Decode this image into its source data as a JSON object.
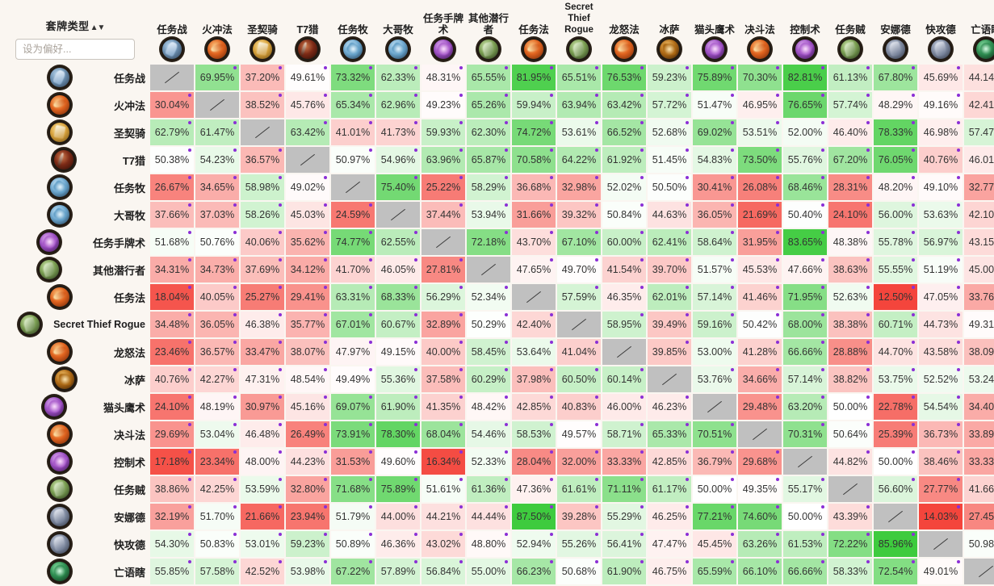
{
  "header": {
    "corner_title": "套牌类型",
    "sort_arrows": "▲▼",
    "search_placeholder": "设为偏好...",
    "search_value": ""
  },
  "legend": {
    "mirror_symbol": "/",
    "dot_color": "#8b2fd6",
    "mirror_color": "#c0c0c0",
    "high_color": "#3ecb3e",
    "mid_color": "#ffffff",
    "low_color": "#f4453c",
    "page_background": "#faf6f1"
  },
  "chart_data": {
    "type": "heatmap",
    "title": "套牌类型",
    "xlabel": "",
    "ylabel": "",
    "value_suffix": "%",
    "mirror_label": "/",
    "categories": [
      {
        "label": "任务战",
        "icon": "warrior-class-icon",
        "cls": "ic-warrior",
        "latin": false
      },
      {
        "label": "火冲法",
        "icon": "mage-class-icon",
        "cls": "ic-mage",
        "latin": false
      },
      {
        "label": "圣契骑",
        "icon": "paladin-class-icon",
        "cls": "ic-paladin",
        "latin": false
      },
      {
        "label": "T7猎",
        "icon": "hunter-class-icon",
        "cls": "ic-hunter",
        "latin": false
      },
      {
        "label": "任务牧",
        "icon": "priest-class-icon",
        "cls": "ic-priest",
        "latin": false
      },
      {
        "label": "大哥牧",
        "icon": "priest-class-icon",
        "cls": "ic-priest",
        "latin": false
      },
      {
        "label": "任务手牌术",
        "icon": "warlock-class-icon",
        "cls": "ic-warlock",
        "latin": false
      },
      {
        "label": "其他潜行者",
        "icon": "rogue-class-icon",
        "cls": "ic-rogue",
        "latin": false
      },
      {
        "label": "任务法",
        "icon": "mage-class-icon",
        "cls": "ic-mage",
        "latin": false
      },
      {
        "label": "Secret Thief Rogue",
        "icon": "rogue-class-icon",
        "cls": "ic-rogue",
        "latin": true
      },
      {
        "label": "龙怒法",
        "icon": "mage-class-icon",
        "cls": "ic-mage",
        "latin": false
      },
      {
        "label": "冰萨",
        "icon": "shaman-class-icon",
        "cls": "ic-shaman",
        "latin": false
      },
      {
        "label": "猫头鹰术",
        "icon": "warlock-class-icon",
        "cls": "ic-warlock",
        "latin": false
      },
      {
        "label": "决斗法",
        "icon": "mage-class-icon",
        "cls": "ic-mage",
        "latin": false
      },
      {
        "label": "控制术",
        "icon": "warlock-class-icon",
        "cls": "ic-warlock",
        "latin": false
      },
      {
        "label": "任务贼",
        "icon": "rogue-class-icon",
        "cls": "ic-rogue",
        "latin": false
      },
      {
        "label": "安娜德",
        "icon": "druid-class-icon",
        "cls": "ic-druid",
        "latin": false
      },
      {
        "label": "快攻德",
        "icon": "druid-class-icon",
        "cls": "ic-druid",
        "latin": false
      },
      {
        "label": "亡语瞎",
        "icon": "demonhunter-class-icon",
        "cls": "ic-dk",
        "latin": false
      }
    ],
    "rows": [
      {
        "label": "任务战",
        "icon": "warrior-class-icon",
        "cls": "ic-warrior",
        "latin": false,
        "values": [
          null,
          69.95,
          37.2,
          49.61,
          73.32,
          62.33,
          48.31,
          65.55,
          81.95,
          65.51,
          76.53,
          59.23,
          75.89,
          70.3,
          82.81,
          61.13,
          67.8,
          45.69,
          44.14
        ]
      },
      {
        "label": "火冲法",
        "icon": "mage-class-icon",
        "cls": "ic-mage",
        "latin": false,
        "values": [
          30.04,
          null,
          38.52,
          45.76,
          65.34,
          62.96,
          49.23,
          65.26,
          59.94,
          63.94,
          63.42,
          57.72,
          51.47,
          46.95,
          76.65,
          57.74,
          48.29,
          49.16,
          42.41
        ]
      },
      {
        "label": "圣契骑",
        "icon": "paladin-class-icon",
        "cls": "ic-paladin",
        "latin": false,
        "values": [
          62.79,
          61.47,
          null,
          63.42,
          41.01,
          41.73,
          59.93,
          62.3,
          74.72,
          53.61,
          66.52,
          52.68,
          69.02,
          53.51,
          52.0,
          46.4,
          78.33,
          46.98,
          57.47
        ]
      },
      {
        "label": "T7猎",
        "icon": "hunter-class-icon",
        "cls": "ic-hunter",
        "latin": false,
        "values": [
          50.38,
          54.23,
          36.57,
          null,
          50.97,
          54.96,
          63.96,
          65.87,
          70.58,
          64.22,
          61.92,
          51.45,
          54.83,
          73.5,
          55.76,
          67.2,
          76.05,
          40.76,
          46.01
        ]
      },
      {
        "label": "任务牧",
        "icon": "priest-class-icon",
        "cls": "ic-priest",
        "latin": false,
        "values": [
          26.67,
          34.65,
          58.98,
          49.02,
          null,
          75.4,
          25.22,
          58.29,
          36.68,
          32.98,
          52.02,
          50.5,
          30.41,
          26.08,
          68.46,
          28.31,
          48.2,
          49.1,
          32.77
        ]
      },
      {
        "label": "大哥牧",
        "icon": "priest-class-icon",
        "cls": "ic-priest",
        "latin": false,
        "values": [
          37.66,
          37.03,
          58.26,
          45.03,
          24.59,
          null,
          37.44,
          53.94,
          31.66,
          39.32,
          50.84,
          44.63,
          36.05,
          21.69,
          50.4,
          24.1,
          56.0,
          53.63,
          42.1
        ]
      },
      {
        "label": "任务手牌术",
        "icon": "warlock-class-icon",
        "cls": "ic-warlock",
        "latin": false,
        "values": [
          51.68,
          50.76,
          40.06,
          35.62,
          74.77,
          62.55,
          null,
          72.18,
          43.7,
          67.1,
          60.0,
          62.41,
          58.64,
          31.95,
          83.65,
          48.38,
          55.78,
          56.97,
          43.15
        ]
      },
      {
        "label": "其他潜行者",
        "icon": "rogue-class-icon",
        "cls": "ic-rogue",
        "latin": false,
        "values": [
          34.31,
          34.73,
          37.69,
          34.12,
          41.7,
          46.05,
          27.81,
          null,
          47.65,
          49.7,
          41.54,
          39.7,
          51.57,
          45.53,
          47.66,
          38.63,
          55.55,
          51.19,
          45.0
        ]
      },
      {
        "label": "任务法",
        "icon": "mage-class-icon",
        "cls": "ic-mage",
        "latin": false,
        "values": [
          18.04,
          40.05,
          25.27,
          29.41,
          63.31,
          68.33,
          56.29,
          52.34,
          null,
          57.59,
          46.35,
          62.01,
          57.14,
          41.46,
          71.95,
          52.63,
          12.5,
          47.05,
          33.76
        ]
      },
      {
        "label": "Secret Thief Rogue",
        "icon": "rogue-class-icon",
        "cls": "ic-rogue",
        "latin": true,
        "values": [
          34.48,
          36.05,
          46.38,
          35.77,
          67.01,
          60.67,
          32.89,
          50.29,
          42.4,
          null,
          58.95,
          39.49,
          59.16,
          50.42,
          68.0,
          38.38,
          60.71,
          44.73,
          49.31
        ]
      },
      {
        "label": "龙怒法",
        "icon": "mage-class-icon",
        "cls": "ic-mage",
        "latin": false,
        "values": [
          23.46,
          36.57,
          33.47,
          38.07,
          47.97,
          49.15,
          40.0,
          58.45,
          53.64,
          41.04,
          null,
          39.85,
          53.0,
          41.28,
          66.66,
          28.88,
          44.7,
          43.58,
          38.09
        ]
      },
      {
        "label": "冰萨",
        "icon": "shaman-class-icon",
        "cls": "ic-shaman",
        "latin": false,
        "values": [
          40.76,
          42.27,
          47.31,
          48.54,
          49.49,
          55.36,
          37.58,
          60.29,
          37.98,
          60.5,
          60.14,
          null,
          53.76,
          34.66,
          57.14,
          38.82,
          53.75,
          52.52,
          53.24
        ]
      },
      {
        "label": "猫头鹰术",
        "icon": "warlock-class-icon",
        "cls": "ic-warlock",
        "latin": false,
        "values": [
          24.1,
          48.19,
          30.97,
          45.16,
          69.07,
          61.9,
          41.35,
          48.42,
          42.85,
          40.83,
          46.0,
          46.23,
          null,
          29.48,
          63.2,
          50.0,
          22.78,
          54.54,
          34.4
        ]
      },
      {
        "label": "决斗法",
        "icon": "mage-class-icon",
        "cls": "ic-mage",
        "latin": false,
        "values": [
          29.69,
          53.04,
          46.48,
          26.49,
          73.91,
          78.3,
          68.04,
          54.46,
          58.53,
          49.57,
          58.71,
          65.33,
          70.51,
          null,
          70.31,
          50.64,
          25.39,
          36.73,
          33.89
        ]
      },
      {
        "label": "控制术",
        "icon": "warlock-class-icon",
        "cls": "ic-warlock",
        "latin": false,
        "values": [
          17.18,
          23.34,
          48.0,
          44.23,
          31.53,
          49.6,
          16.34,
          52.33,
          28.04,
          32.0,
          33.33,
          42.85,
          36.79,
          29.68,
          null,
          44.82,
          50.0,
          38.46,
          33.33
        ]
      },
      {
        "label": "任务贼",
        "icon": "rogue-class-icon",
        "cls": "ic-rogue",
        "latin": false,
        "values": [
          38.86,
          42.25,
          53.59,
          32.8,
          71.68,
          75.89,
          51.61,
          61.36,
          47.36,
          61.61,
          71.11,
          61.17,
          50.0,
          49.35,
          55.17,
          null,
          56.6,
          27.77,
          41.66
        ]
      },
      {
        "label": "安娜德",
        "icon": "druid-class-icon",
        "cls": "ic-druid",
        "latin": false,
        "values": [
          32.19,
          51.7,
          21.66,
          23.94,
          51.79,
          44.0,
          44.21,
          44.44,
          87.5,
          39.28,
          55.29,
          46.25,
          77.21,
          74.6,
          50.0,
          43.39,
          null,
          14.03,
          27.45
        ]
      },
      {
        "label": "快攻德",
        "icon": "druid-class-icon",
        "cls": "ic-druid",
        "latin": false,
        "values": [
          54.3,
          50.83,
          53.01,
          59.23,
          50.89,
          46.36,
          43.02,
          48.8,
          52.94,
          55.26,
          56.41,
          47.47,
          45.45,
          63.26,
          61.53,
          72.22,
          85.96,
          null,
          50.98
        ]
      },
      {
        "label": "亡语瞎",
        "icon": "demonhunter-class-icon",
        "cls": "ic-dk",
        "latin": false,
        "values": [
          55.85,
          57.58,
          42.52,
          53.98,
          67.22,
          57.89,
          56.84,
          55.0,
          66.23,
          50.68,
          61.9,
          46.75,
          65.59,
          66.1,
          66.66,
          58.33,
          72.54,
          49.01,
          null
        ]
      }
    ]
  }
}
